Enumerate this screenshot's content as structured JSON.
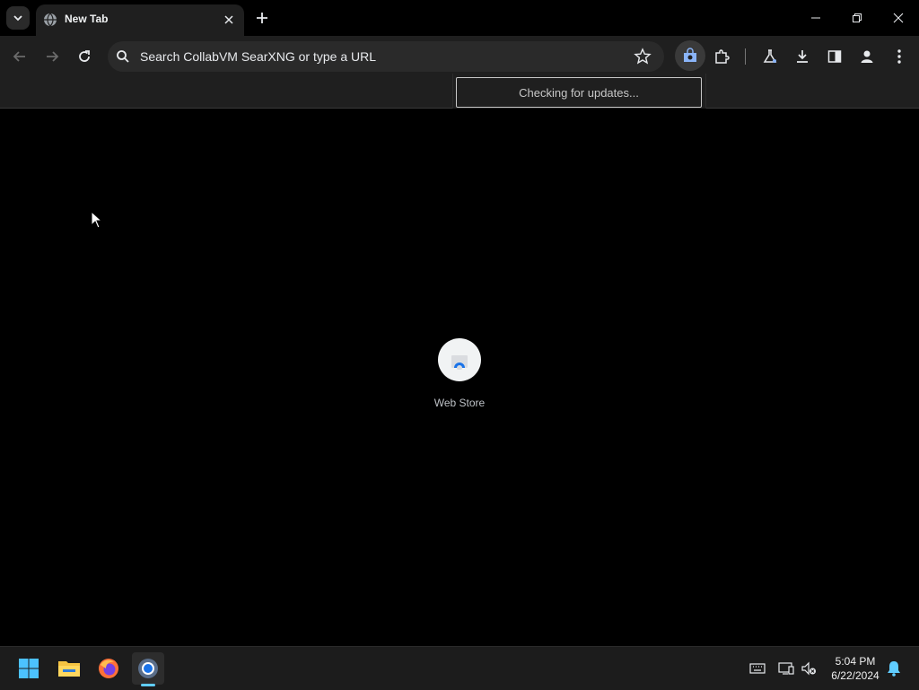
{
  "tab": {
    "title": "New Tab"
  },
  "omnibox": {
    "text": "Search CollabVM SearXNG or type a URL"
  },
  "popup": {
    "text": "Checking for updates..."
  },
  "shortcuts": [
    {
      "label": "Web Store"
    }
  ],
  "taskbar": {
    "time": "5:04 PM",
    "date": "6/22/2024",
    "apps": [
      "start-icon",
      "file-explorer-icon",
      "firefox-icon",
      "chrome-icon"
    ]
  },
  "colors": {
    "accent": "#60cdff",
    "background": "#000000",
    "toolbar": "#1f1f1f"
  }
}
